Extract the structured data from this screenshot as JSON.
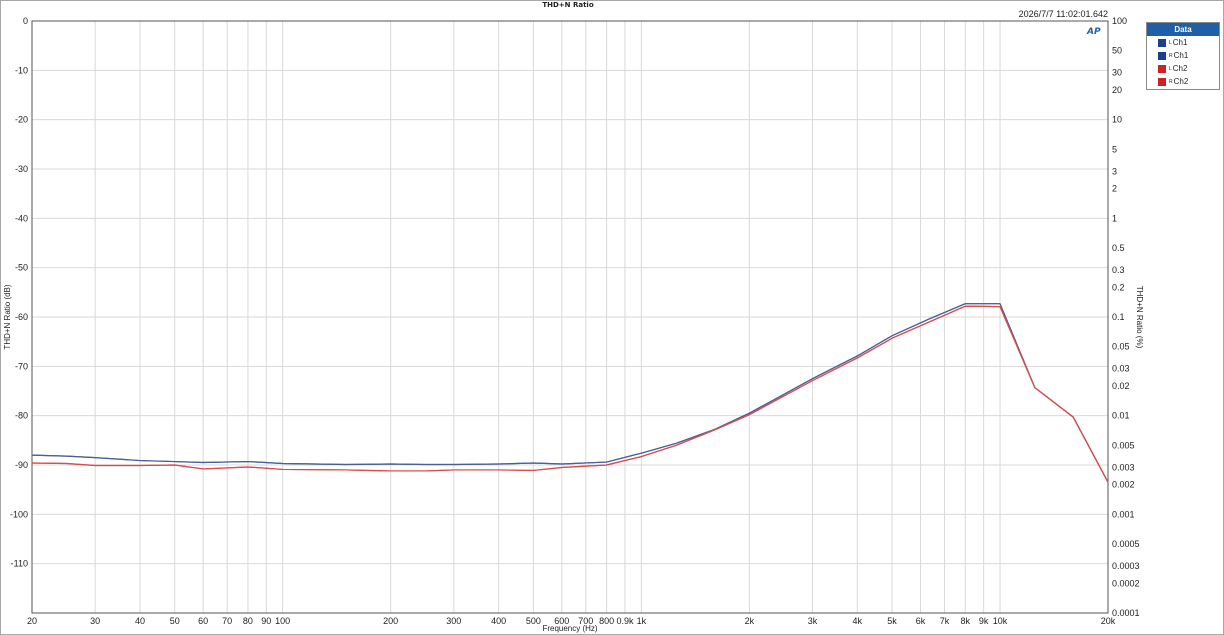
{
  "title": "THD+N Ratio",
  "timestamp": "2026/7/7 11:02:01.642",
  "logo_text": "AP",
  "legend": {
    "header": "Data",
    "items": [
      {
        "sup": "L",
        "label": "Ch1",
        "color": "#1a3f8c"
      },
      {
        "sup": "R",
        "label": "Ch1",
        "color": "#1a3f8c"
      },
      {
        "sup": "L",
        "label": "Ch2",
        "color": "#cc2222"
      },
      {
        "sup": "R",
        "label": "Ch2",
        "color": "#cc2222"
      }
    ]
  },
  "chart_data": {
    "type": "line",
    "title": "THD+N Ratio",
    "xlabel": "Frequency (Hz)",
    "ylabel": "THD+N Ratio (dB)",
    "y2label": "THD+N Ratio (%)",
    "xscale": "log",
    "xlim": [
      20,
      20000
    ],
    "ylim": [
      -120,
      0
    ],
    "y2scale": "log",
    "x_ticks": [
      {
        "v": 20,
        "label": "20"
      },
      {
        "v": 30,
        "label": "30"
      },
      {
        "v": 40,
        "label": "40"
      },
      {
        "v": 50,
        "label": "50"
      },
      {
        "v": 60,
        "label": "60"
      },
      {
        "v": 70,
        "label": "70"
      },
      {
        "v": 80,
        "label": "80"
      },
      {
        "v": 90,
        "label": "90"
      },
      {
        "v": 100,
        "label": "100"
      },
      {
        "v": 200,
        "label": "200"
      },
      {
        "v": 300,
        "label": "300"
      },
      {
        "v": 400,
        "label": "400"
      },
      {
        "v": 500,
        "label": "500"
      },
      {
        "v": 600,
        "label": "600"
      },
      {
        "v": 700,
        "label": "700"
      },
      {
        "v": 800,
        "label": "800"
      },
      {
        "v": 900,
        "label": "0.9k"
      },
      {
        "v": 1000,
        "label": "1k"
      },
      {
        "v": 2000,
        "label": "2k"
      },
      {
        "v": 3000,
        "label": "3k"
      },
      {
        "v": 4000,
        "label": "4k"
      },
      {
        "v": 5000,
        "label": "5k"
      },
      {
        "v": 6000,
        "label": "6k"
      },
      {
        "v": 7000,
        "label": "7k"
      },
      {
        "v": 8000,
        "label": "8k"
      },
      {
        "v": 9000,
        "label": "9k"
      },
      {
        "v": 10000,
        "label": "10k"
      },
      {
        "v": 20000,
        "label": "20k"
      }
    ],
    "y_ticks": [
      {
        "v": 0,
        "label": "0"
      },
      {
        "v": -10,
        "label": "-10"
      },
      {
        "v": -20,
        "label": "-20"
      },
      {
        "v": -30,
        "label": "-30"
      },
      {
        "v": -40,
        "label": "-40"
      },
      {
        "v": -50,
        "label": "-50"
      },
      {
        "v": -60,
        "label": "-60"
      },
      {
        "v": -70,
        "label": "-70"
      },
      {
        "v": -80,
        "label": "-80"
      },
      {
        "v": -90,
        "label": "-90"
      },
      {
        "v": -100,
        "label": "-100"
      },
      {
        "v": -110,
        "label": "-110"
      }
    ],
    "y2_ticks": [
      {
        "v": 100,
        "label": "100"
      },
      {
        "v": 50,
        "label": "50"
      },
      {
        "v": 30,
        "label": "30"
      },
      {
        "v": 20,
        "label": "20"
      },
      {
        "v": 10,
        "label": "10"
      },
      {
        "v": 5,
        "label": "5"
      },
      {
        "v": 3,
        "label": "3"
      },
      {
        "v": 2,
        "label": "2"
      },
      {
        "v": 1,
        "label": "1"
      },
      {
        "v": 0.5,
        "label": "0.5"
      },
      {
        "v": 0.3,
        "label": "0.3"
      },
      {
        "v": 0.2,
        "label": "0.2"
      },
      {
        "v": 0.1,
        "label": "0.1"
      },
      {
        "v": 0.05,
        "label": "0.05"
      },
      {
        "v": 0.03,
        "label": "0.03"
      },
      {
        "v": 0.02,
        "label": "0.02"
      },
      {
        "v": 0.01,
        "label": "0.01"
      },
      {
        "v": 0.005,
        "label": "0.005"
      },
      {
        "v": 0.003,
        "label": "0.003"
      },
      {
        "v": 0.002,
        "label": "0.002"
      },
      {
        "v": 0.001,
        "label": "0.001"
      },
      {
        "v": 0.0005,
        "label": "0.0005"
      },
      {
        "v": 0.0003,
        "label": "0.0003"
      },
      {
        "v": 0.0002,
        "label": "0.0002"
      },
      {
        "v": 0.0001,
        "label": "0.0001"
      }
    ],
    "series": [
      {
        "name": "Ch1 L",
        "color": "#4a5f9a",
        "x": [
          20,
          25,
          30,
          40,
          50,
          60,
          80,
          100,
          150,
          200,
          250,
          300,
          400,
          500,
          600,
          800,
          1000,
          1250,
          1600,
          2000,
          3000,
          4000,
          5000,
          6300,
          8000,
          10000,
          12500,
          16000,
          20000
        ],
        "y": [
          -88.0,
          -88.2,
          -88.5,
          -89.1,
          -89.3,
          -89.5,
          -89.3,
          -89.7,
          -89.9,
          -89.8,
          -89.9,
          -89.9,
          -89.8,
          -89.6,
          -89.8,
          -89.4,
          -87.6,
          -85.6,
          -82.8,
          -79.5,
          -72.5,
          -67.9,
          -63.8,
          -60.5,
          -57.3,
          -57.3,
          -74.3,
          -80.3,
          -93.5
        ]
      },
      {
        "name": "Ch1 R",
        "color": "#4a5f9a",
        "x": [
          20,
          25,
          30,
          40,
          50,
          60,
          80,
          100,
          150,
          200,
          250,
          300,
          400,
          500,
          600,
          800,
          1000,
          1250,
          1600,
          2000,
          3000,
          4000,
          5000,
          6300,
          8000,
          10000,
          12500,
          16000,
          20000
        ],
        "y": [
          -88.0,
          -88.2,
          -88.5,
          -89.1,
          -89.3,
          -89.5,
          -89.3,
          -89.7,
          -89.9,
          -89.8,
          -89.9,
          -89.9,
          -89.8,
          -89.6,
          -89.8,
          -89.4,
          -87.6,
          -85.6,
          -82.8,
          -79.5,
          -72.5,
          -67.9,
          -63.8,
          -60.5,
          -57.3,
          -57.3,
          -74.3,
          -80.3,
          -93.5
        ]
      },
      {
        "name": "Ch2 L",
        "color": "#d94c4c",
        "x": [
          20,
          25,
          30,
          40,
          50,
          60,
          80,
          100,
          150,
          200,
          250,
          300,
          400,
          500,
          600,
          800,
          1000,
          1250,
          1600,
          2000,
          3000,
          4000,
          5000,
          6300,
          8000,
          10000,
          12500,
          16000,
          20000
        ],
        "y": [
          -89.6,
          -89.7,
          -90.1,
          -90.1,
          -90.0,
          -90.8,
          -90.4,
          -90.9,
          -91.0,
          -91.2,
          -91.2,
          -91.0,
          -91.0,
          -91.1,
          -90.5,
          -90.0,
          -88.3,
          -86.0,
          -82.9,
          -79.8,
          -72.9,
          -68.3,
          -64.3,
          -61.1,
          -57.8,
          -57.9,
          -74.3,
          -80.3,
          -93.5
        ]
      },
      {
        "name": "Ch2 R",
        "color": "#d94c4c",
        "x": [
          20,
          25,
          30,
          40,
          50,
          60,
          80,
          100,
          150,
          200,
          250,
          300,
          400,
          500,
          600,
          800,
          1000,
          1250,
          1600,
          2000,
          3000,
          4000,
          5000,
          6300,
          8000,
          10000,
          12500,
          16000,
          20000
        ],
        "y": [
          -89.6,
          -89.7,
          -90.1,
          -90.1,
          -90.0,
          -90.8,
          -90.4,
          -90.9,
          -91.0,
          -91.2,
          -91.2,
          -91.0,
          -91.0,
          -91.1,
          -90.5,
          -90.0,
          -88.3,
          -86.0,
          -82.9,
          -79.8,
          -72.9,
          -68.3,
          -64.3,
          -61.1,
          -57.8,
          -57.9,
          -74.3,
          -80.3,
          -93.5
        ]
      }
    ],
    "grid": true,
    "legend_position": "top-right"
  }
}
